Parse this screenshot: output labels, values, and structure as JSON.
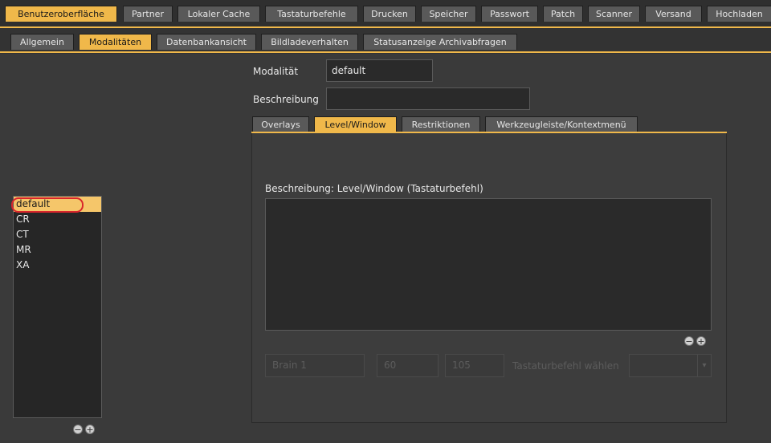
{
  "top_tabs": [
    {
      "label": "Benutzeroberfläche",
      "active": true
    },
    {
      "label": "Partner",
      "active": false
    },
    {
      "label": "Lokaler Cache",
      "active": false
    },
    {
      "label": "Tastaturbefehle",
      "active": false
    },
    {
      "label": "Drucken",
      "active": false
    },
    {
      "label": "Speicher",
      "active": false
    },
    {
      "label": "Passwort",
      "active": false
    },
    {
      "label": "Patch",
      "active": false
    },
    {
      "label": "Scanner",
      "active": false
    },
    {
      "label": "Versand",
      "active": false
    },
    {
      "label": "Hochladen",
      "active": false
    }
  ],
  "sub_tabs": [
    {
      "label": "Allgemein",
      "active": false
    },
    {
      "label": "Modalitäten",
      "active": true
    },
    {
      "label": "Datenbankansicht",
      "active": false
    },
    {
      "label": "Bildladeverhalten",
      "active": false
    },
    {
      "label": "Statusanzeige Archivabfragen",
      "active": false
    }
  ],
  "form": {
    "modality_label": "Modalität",
    "modality_value": "default",
    "description_label": "Beschreibung",
    "description_value": ""
  },
  "inner_tabs": [
    {
      "label": "Overlays",
      "active": false
    },
    {
      "label": "Level/Window",
      "active": true
    },
    {
      "label": "Restriktionen",
      "active": false
    },
    {
      "label": "Werkzeugleiste/Kontextmenü",
      "active": false
    }
  ],
  "panel": {
    "caption": "Beschreibung: Level/Window (Tastaturbefehl)",
    "minus_symbol": "−",
    "plus_symbol": "+",
    "name_value": "Brain 1",
    "level_value": "60",
    "window_value": "105",
    "shortcut_label": "Tastaturbefehl wählen",
    "select_arrow": "▾"
  },
  "modality_list": {
    "items": [
      "default",
      "CR",
      "CT",
      "MR",
      "XA"
    ],
    "selected_index": 0,
    "minus_symbol": "−",
    "plus_symbol": "+"
  },
  "colors": {
    "accent": "#f0b84a",
    "selection": "#f5c66a",
    "highlight_ring": "#d9262b",
    "background": "#3a3a3a"
  }
}
